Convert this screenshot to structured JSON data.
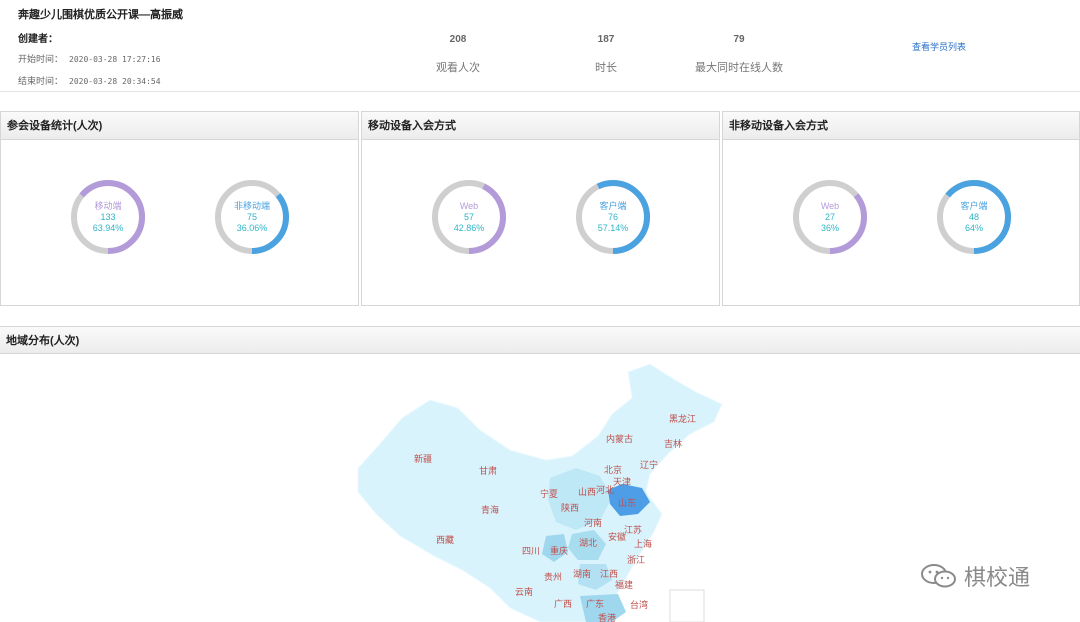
{
  "header": {
    "course_title": "奔趣少儿围棋优质公开课—高振威",
    "creator_label": "创建者：",
    "start_label": "开始时间：",
    "start_value": "2020-03-28 17:27:16",
    "end_label": "结束时间：",
    "end_value": "2020-03-28 20:34:54",
    "stats": [
      {
        "value": "208",
        "label": "观看人次"
      },
      {
        "value": "187",
        "label": "时长"
      },
      {
        "value": "79",
        "label": "最大同时在线人数"
      }
    ],
    "student_list_link": "查看学员列表"
  },
  "panels": [
    {
      "title": "参会设备统计(人次)",
      "donuts": [
        {
          "name": "移动端",
          "count": "133",
          "percent": "63.94%",
          "fraction": 0.6394,
          "color": "#b39ad9"
        },
        {
          "name": "非移动端",
          "count": "75",
          "percent": "36.06%",
          "fraction": 0.3606,
          "color": "#4aa3e0"
        }
      ]
    },
    {
      "title": "移动设备入会方式",
      "donuts": [
        {
          "name": "Web",
          "count": "57",
          "percent": "42.86%",
          "fraction": 0.4286,
          "color": "#b39ad9"
        },
        {
          "name": "客户端",
          "count": "76",
          "percent": "57.14%",
          "fraction": 0.5714,
          "color": "#4aa3e0"
        }
      ]
    },
    {
      "title": "非移动设备入会方式",
      "donuts": [
        {
          "name": "Web",
          "count": "27",
          "percent": "36%",
          "fraction": 0.36,
          "color": "#b39ad9"
        },
        {
          "name": "客户端",
          "count": "48",
          "percent": "64%",
          "fraction": 0.64,
          "color": "#4aa3e0"
        }
      ]
    }
  ],
  "map": {
    "title": "地域分布(人次)",
    "provinces": [
      "黑龙江",
      "吉林",
      "内蒙古",
      "辽宁",
      "新疆",
      "甘肃",
      "北京",
      "天津",
      "河北",
      "宁夏",
      "山西",
      "山东",
      "青海",
      "陕西",
      "河南",
      "江苏",
      "西藏",
      "四川",
      "重庆",
      "湖北",
      "安徽",
      "上海",
      "浙江",
      "贵州",
      "湖南",
      "江西",
      "福建",
      "云南",
      "广西",
      "广东",
      "台湾",
      "香港"
    ]
  },
  "watermark": {
    "text": "棋校通"
  },
  "colors": {
    "accent_purple": "#b39ad9",
    "accent_blue": "#4aa3e0",
    "ring_track": "#cfcfcf",
    "map_fill": "#d8f3fb",
    "map_highlight": "#4d9ee6",
    "link": "#2a6fc9"
  }
}
